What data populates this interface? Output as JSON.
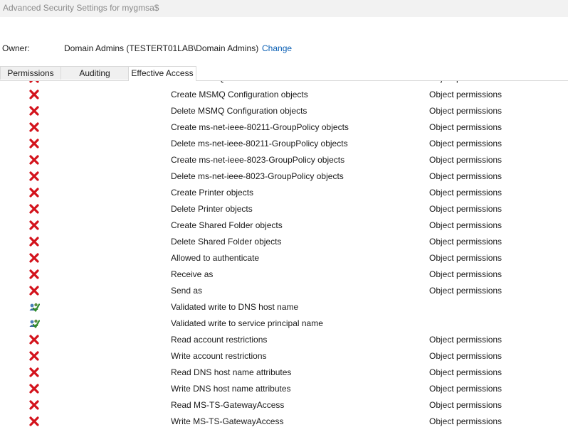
{
  "window": {
    "title": "Advanced Security Settings for mygmsa$"
  },
  "owner": {
    "label": "Owner:",
    "value": "Domain Admins (TESTERT01LAB\\Domain Admins)",
    "change_label": "Change"
  },
  "tabs": [
    {
      "label": "Permissions",
      "selected": false
    },
    {
      "label": "Auditing",
      "selected": false
    },
    {
      "label": "Effective Access",
      "selected": true
    }
  ],
  "entries": [
    {
      "icon": "denied-x-icon",
      "permission": "Delete MSMQ...",
      "scope": "Object permissions"
    },
    {
      "icon": "denied-x-icon",
      "permission": "Create MSMQ Configuration objects",
      "scope": "Object permissions"
    },
    {
      "icon": "denied-x-icon",
      "permission": "Delete MSMQ Configuration objects",
      "scope": "Object permissions"
    },
    {
      "icon": "denied-x-icon",
      "permission": "Create ms-net-ieee-80211-GroupPolicy objects",
      "scope": "Object permissions"
    },
    {
      "icon": "denied-x-icon",
      "permission": "Delete ms-net-ieee-80211-GroupPolicy objects",
      "scope": "Object permissions"
    },
    {
      "icon": "denied-x-icon",
      "permission": "Create ms-net-ieee-8023-GroupPolicy objects",
      "scope": "Object permissions"
    },
    {
      "icon": "denied-x-icon",
      "permission": "Delete ms-net-ieee-8023-GroupPolicy objects",
      "scope": "Object permissions"
    },
    {
      "icon": "denied-x-icon",
      "permission": "Create Printer objects",
      "scope": "Object permissions"
    },
    {
      "icon": "denied-x-icon",
      "permission": "Delete Printer objects",
      "scope": "Object permissions"
    },
    {
      "icon": "denied-x-icon",
      "permission": "Create Shared Folder objects",
      "scope": "Object permissions"
    },
    {
      "icon": "denied-x-icon",
      "permission": "Delete Shared Folder objects",
      "scope": "Object permissions"
    },
    {
      "icon": "denied-x-icon",
      "permission": "Allowed to authenticate",
      "scope": "Object permissions"
    },
    {
      "icon": "denied-x-icon",
      "permission": "Receive as",
      "scope": "Object permissions"
    },
    {
      "icon": "denied-x-icon",
      "permission": "Send as",
      "scope": "Object permissions"
    },
    {
      "icon": "allowed-users-check-icon",
      "permission": "Validated write to DNS host name",
      "scope": ""
    },
    {
      "icon": "allowed-users-check-icon",
      "permission": "Validated write to service principal name",
      "scope": ""
    },
    {
      "icon": "denied-x-icon",
      "permission": "Read account restrictions",
      "scope": "Object permissions"
    },
    {
      "icon": "denied-x-icon",
      "permission": "Write account restrictions",
      "scope": "Object permissions"
    },
    {
      "icon": "denied-x-icon",
      "permission": "Read DNS host name attributes",
      "scope": "Object permissions"
    },
    {
      "icon": "denied-x-icon",
      "permission": "Write DNS host name attributes",
      "scope": "Object permissions"
    },
    {
      "icon": "denied-x-icon",
      "permission": "Read MS-TS-GatewayAccess",
      "scope": "Object permissions"
    },
    {
      "icon": "denied-x-icon",
      "permission": "Write MS-TS-GatewayAccess",
      "scope": "Object permissions"
    }
  ],
  "colors": {
    "denied": "#d3121b",
    "link": "#0a5fb4",
    "check": "#2e8b2e"
  }
}
